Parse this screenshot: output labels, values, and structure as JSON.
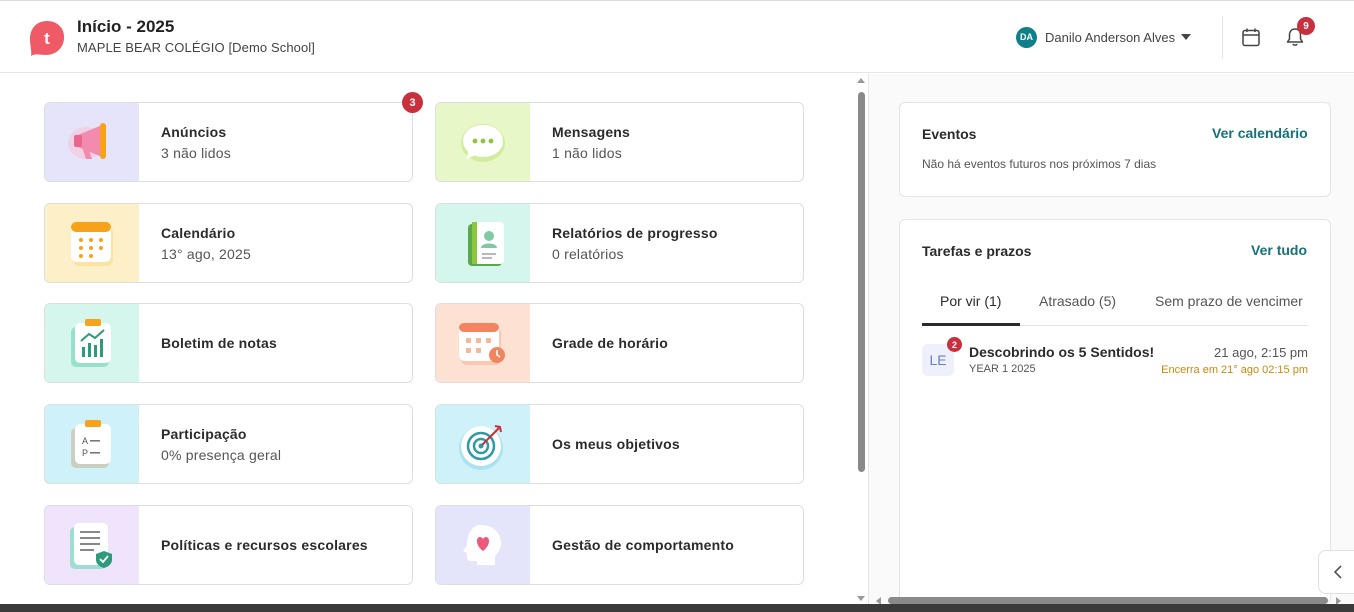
{
  "header": {
    "title": "Início - 2025",
    "subtitle": "MAPLE BEAR COLÉGIO [Demo School]",
    "logo_letter": "t",
    "user_initials": "DA",
    "user_name": "Danilo Anderson Alves",
    "notifications_count": "9"
  },
  "cards": [
    {
      "title": "Anúncios",
      "subtitle": "3 não lidos",
      "badge": "3",
      "icon": "megaphone-icon",
      "bg": "#e6e4fb"
    },
    {
      "title": "Mensagens",
      "subtitle": "1 não lidos",
      "icon": "chat-bubble-icon",
      "bg": "#e8f7c8"
    },
    {
      "title": "Calendário",
      "subtitle": "13° ago, 2025",
      "icon": "calendar-icon",
      "bg": "#fdf0c8"
    },
    {
      "title": "Relatórios de progresso",
      "subtitle": "0 relatórios",
      "icon": "report-book-icon",
      "bg": "#d4f6ec"
    },
    {
      "title": "Boletim de notas",
      "subtitle": "",
      "icon": "chart-clipboard-icon",
      "bg": "#d4f6ec"
    },
    {
      "title": "Grade de horário",
      "subtitle": "",
      "icon": "schedule-icon",
      "bg": "#fde2d4"
    },
    {
      "title": "Participação",
      "subtitle": "0% presença geral",
      "icon": "attendance-clipboard-icon",
      "bg": "#cff1fa"
    },
    {
      "title": "Os meus objetivos",
      "subtitle": "",
      "icon": "target-icon",
      "bg": "#cff1fa"
    },
    {
      "title": "Políticas e recursos escolares",
      "subtitle": "",
      "icon": "policy-document-icon",
      "bg": "#efe4fb"
    },
    {
      "title": "Gestão de comportamento",
      "subtitle": "",
      "icon": "heart-head-icon",
      "bg": "#e4e4fb"
    }
  ],
  "events": {
    "title": "Eventos",
    "link": "Ver calendário",
    "empty_text": "Não há eventos futuros nos próximos 7 dias"
  },
  "tasks": {
    "title": "Tarefas e prazos",
    "link": "Ver tudo",
    "tabs": [
      "Por vir (1)",
      "Atrasado (5)",
      "Sem prazo de vencimer"
    ],
    "items": [
      {
        "initials": "LE",
        "badge": "2",
        "title": "Descobrindo os 5 Sentidos!",
        "class": "YEAR 1 2025",
        "date": "21 ago, 2:15 pm",
        "closes": "Encerra em 21° ago 02:15 pm"
      }
    ]
  },
  "colors": {
    "accent": "#16717a",
    "badge": "#c9303e",
    "warning": "#c88a0d",
    "logo": "#f05a66"
  }
}
